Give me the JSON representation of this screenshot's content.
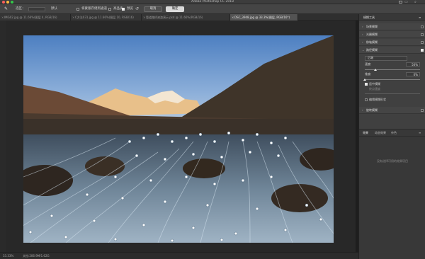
{
  "window": {
    "title": "Adobe Photoshop CC 2018",
    "traffic_colors": [
      "#fc605c",
      "#fdbc40",
      "#34c84a"
    ]
  },
  "options_bar": {
    "preset_label": "选区：",
    "preset_value": "默认",
    "pin_edges": "将蒙版存储到通道",
    "high_quality": "高品质",
    "preview": "预览",
    "cancel": "取消",
    "ok": "确定"
  },
  "tabs": [
    {
      "label": "IMG02.jpg @ 11.66%(图层 4, RGB/16)",
      "active": false
    },
    {
      "label": "C方法031.jpg @ 11.66%(图层 10, RGB/16)",
      "active": false
    },
    {
      "label": "管道路桥液渣演示.psd @ 11.66%(RGB/16)",
      "active": false
    },
    {
      "label": "DSC_3948.jpg @ 33.3%(图层, RGB/16*)",
      "active": true
    }
  ],
  "status": {
    "zoom": "33.33%",
    "doc": "文档:206.9M/1.62G"
  },
  "panel": {
    "header": "模糊工具",
    "sections": [
      {
        "label": "场景模糊",
        "checked": false,
        "expanded": false
      },
      {
        "label": "光圈模糊",
        "checked": false,
        "expanded": false
      },
      {
        "label": "移轴模糊",
        "checked": false,
        "expanded": false
      },
      {
        "label": "路径模糊",
        "checked": true,
        "expanded": true
      }
    ],
    "path_blur": {
      "mode": "后端",
      "speed_label": "速度:",
      "speed_value": "50%",
      "taper_label": "锥度:",
      "taper_value": "0%",
      "centered_label": "居中模糊",
      "end_speed_label": "终点速度",
      "edit_shapes_label": "编辑模糊形状"
    },
    "rotate_section": {
      "label": "旋转模糊",
      "checked": false
    },
    "lower_tabs": [
      "效果",
      "动态效果",
      "杂色"
    ],
    "lower_empty": "没有选择可用的效果项目"
  }
}
